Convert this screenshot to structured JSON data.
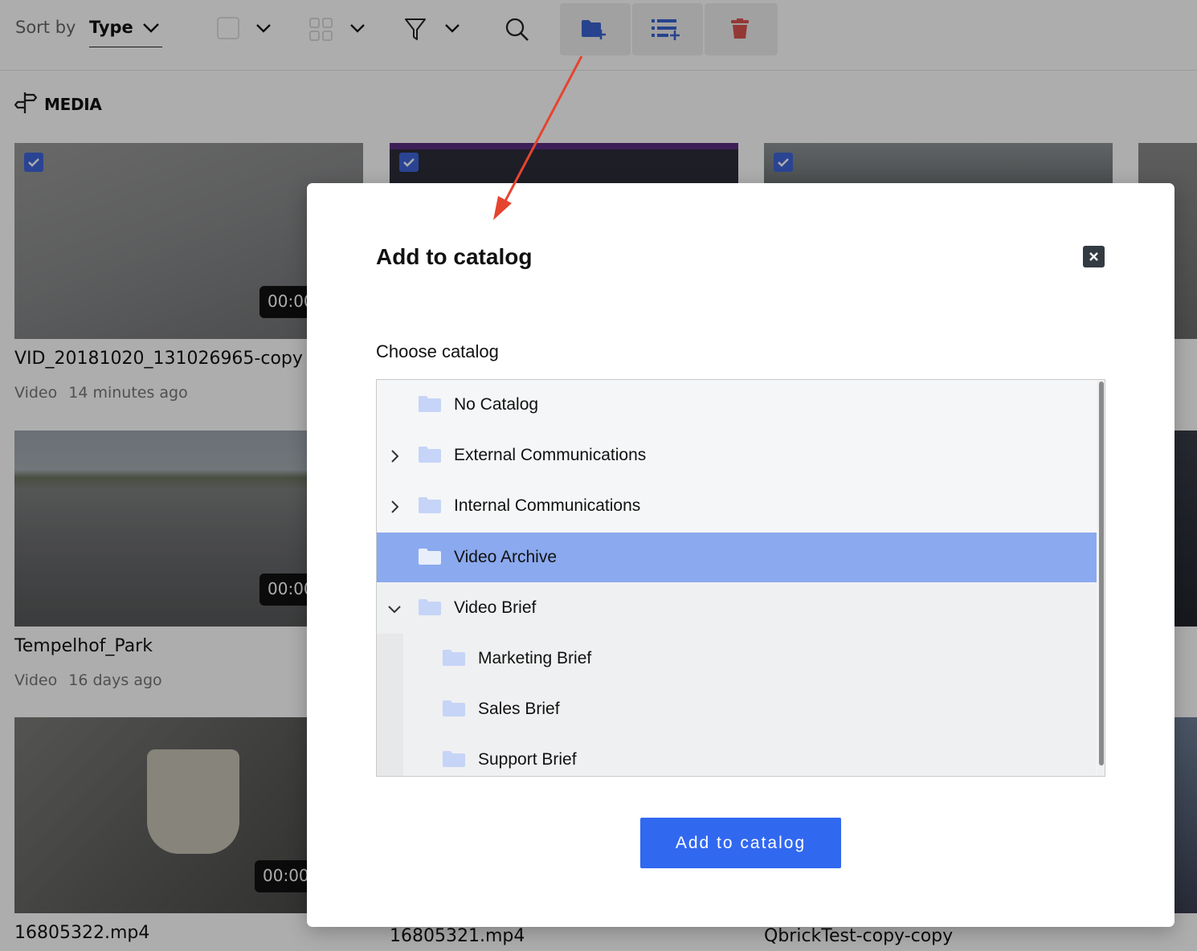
{
  "toolbar": {
    "sort_label": "Sort by",
    "sort_value": "Type",
    "icons": [
      "select-all-checkbox-icon",
      "grid-view-icon",
      "filter-icon",
      "search-icon",
      "add-to-catalog-icon",
      "add-to-list-icon",
      "trash-icon"
    ]
  },
  "section": {
    "title": "MEDIA",
    "icon": "signpost-icon"
  },
  "media": [
    {
      "title": "VID_20181020_131026965-copy",
      "type": "Video",
      "time": "14 minutes ago",
      "duration": "00:00",
      "checked": true
    },
    {
      "title": "Tempelhof_Park",
      "type": "Video",
      "time": "16 days ago",
      "duration": "00:00",
      "checked": false
    },
    {
      "title": "16805322.mp4",
      "duration": "00:00",
      "checked": false
    },
    {
      "title": "16805321.mp4",
      "checked": true
    },
    {
      "title": "QbrickTest-copy-copy",
      "checked": true
    }
  ],
  "modal": {
    "title": "Add to catalog",
    "choose_label": "Choose catalog",
    "submit_label": "Add to catalog",
    "catalogs": [
      {
        "label": "No Catalog",
        "expandable": false,
        "level": 0
      },
      {
        "label": "External Communications",
        "expandable": true,
        "expanded": false,
        "level": 0
      },
      {
        "label": "Internal Communications",
        "expandable": true,
        "expanded": false,
        "level": 0
      },
      {
        "label": "Video Archive",
        "expandable": false,
        "level": 0,
        "selected": true
      },
      {
        "label": "Video Brief",
        "expandable": true,
        "expanded": true,
        "level": 0
      },
      {
        "label": "Marketing Brief",
        "level": 1
      },
      {
        "label": "Sales Brief",
        "level": 1
      },
      {
        "label": "Support Brief",
        "level": 1
      }
    ]
  },
  "colors": {
    "accent": "#3168f0",
    "selected_row": "#8ba9ee",
    "folder": "#c5d4f7",
    "trash": "#d9534f"
  }
}
